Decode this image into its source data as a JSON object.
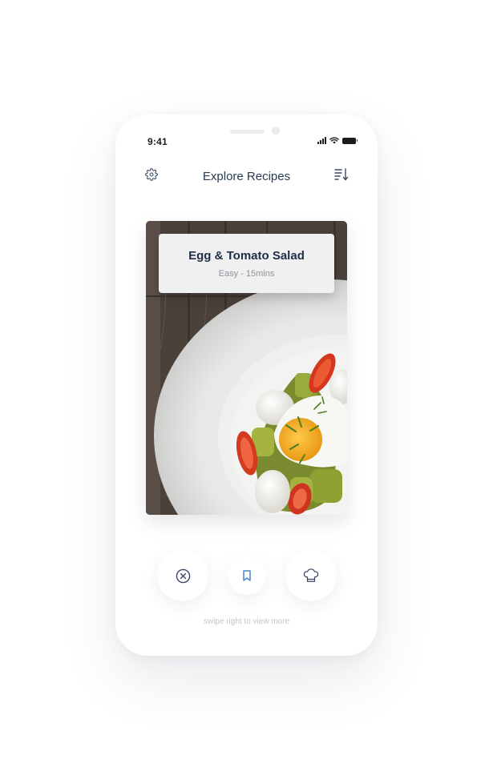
{
  "status_bar": {
    "time": "9:41"
  },
  "header": {
    "title": "Explore Recipes",
    "settings_icon": "gear-icon",
    "sort_icon": "sort-icon"
  },
  "recipe_card": {
    "name": "Egg & Tomato Salad",
    "meta": "Easy - 15mins",
    "image": "egg-tomato-salad-photo"
  },
  "actions": [
    {
      "icon": "close-circle-icon"
    },
    {
      "icon": "bookmark-icon"
    },
    {
      "icon": "chef-hat-icon"
    }
  ],
  "hint": "swipe right to view more",
  "colors": {
    "title": "#2a3b55",
    "accent_blue": "#4a86c8",
    "icon": "#3a4a66"
  }
}
